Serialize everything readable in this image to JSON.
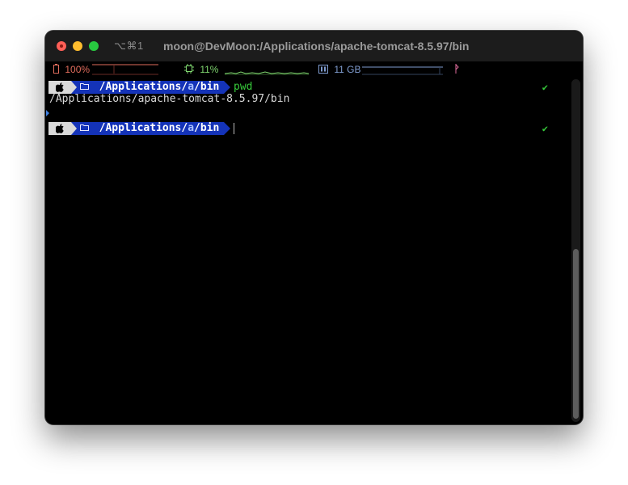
{
  "window": {
    "shortcut": "⌥⌘1",
    "title": "moon@DevMoon:/Applications/apache-tomcat-8.5.97/bin"
  },
  "status": {
    "battery_icon": "battery-icon",
    "battery": "100%",
    "cpu_icon": "cpu-icon",
    "cpu": "11%",
    "memory_icon": "memory-icon",
    "memory": "11 GB",
    "network_icon": "network-icon",
    "colors": {
      "battery": "#e06c5c",
      "cpu": "#7fd66f",
      "memory": "#7f9ccf",
      "network": "#e06c9c"
    }
  },
  "terminal": {
    "prompt1": {
      "apple_icon": "apple-icon",
      "folder_icon": "folder-icon",
      "path_prefix": "/Applications/",
      "path_abbrev": "a",
      "path_suffix": "/bin",
      "command": "pwd",
      "status": "✔"
    },
    "output": "/Applications/apache-tomcat-8.5.97/bin",
    "prompt2": {
      "apple_icon": "apple-icon",
      "folder_icon": "folder-icon",
      "path_prefix": "/Applications/",
      "path_abbrev": "a",
      "path_suffix": "/bin",
      "command": "",
      "status": "✔"
    }
  },
  "colors": {
    "prompt_segment": "#1433b8",
    "command": "#36c93a",
    "background": "#000000"
  }
}
